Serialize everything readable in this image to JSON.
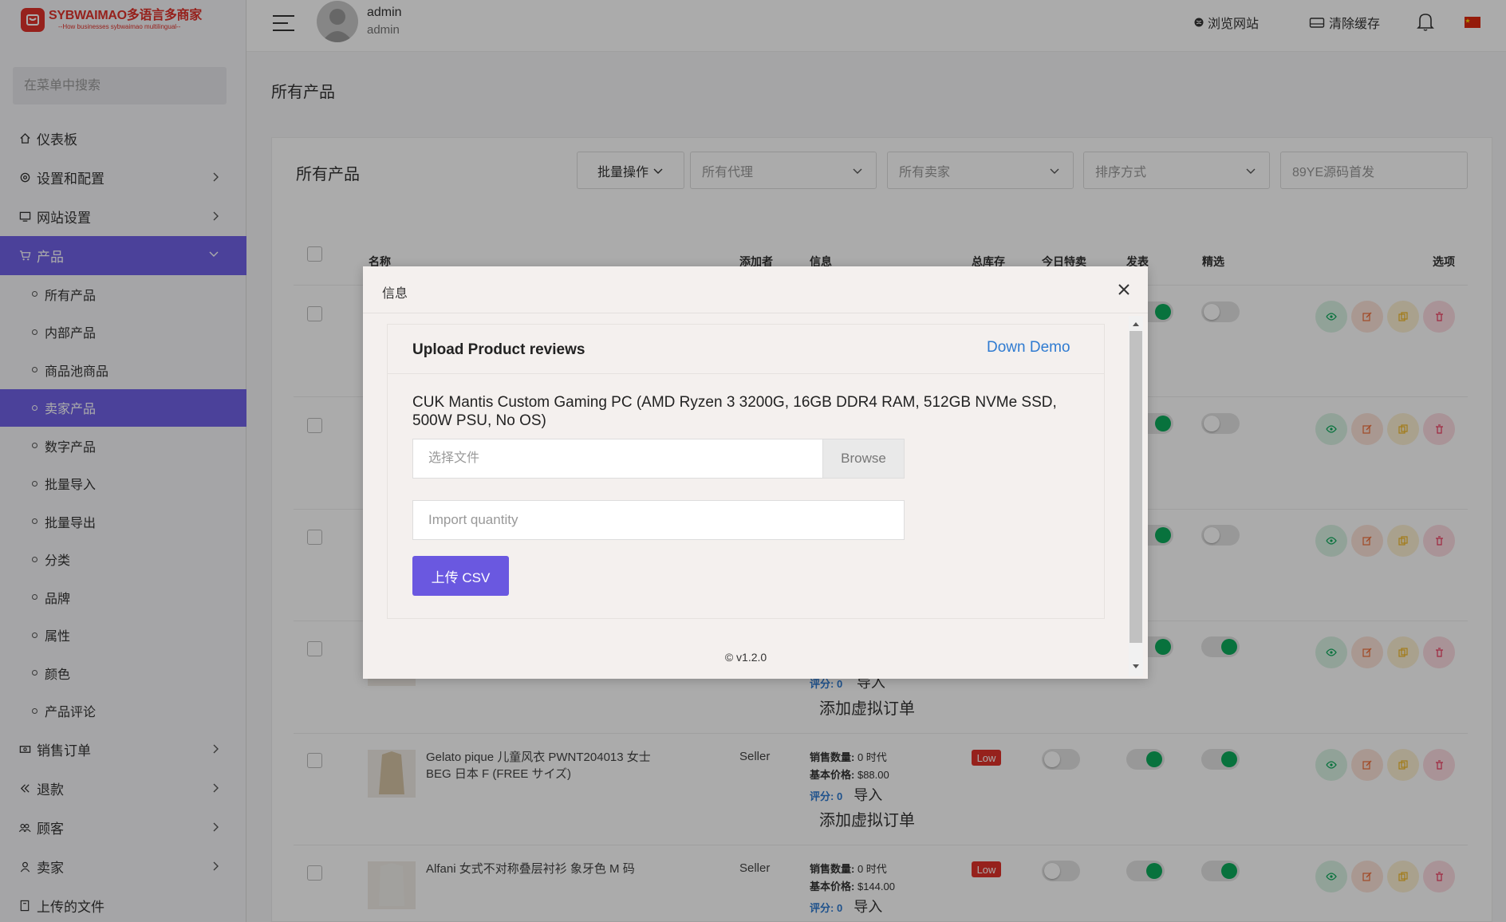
{
  "sidebar": {
    "logo_title": "SYBWAIMAO多语言多商家",
    "logo_sub": "--How businesses sybwaimao multilingual--",
    "search_placeholder": "在菜单中搜索",
    "items": [
      {
        "label": "仪表板",
        "icon": "home-icon"
      },
      {
        "label": "设置和配置",
        "icon": "settings-icon"
      },
      {
        "label": "网站设置",
        "icon": "monitor-icon"
      },
      {
        "label": "产品",
        "icon": "cart-icon"
      }
    ],
    "sub_items": [
      "所有产品",
      "内部产品",
      "商品池商品",
      "卖家产品",
      "数字产品",
      "批量导入",
      "批量导出",
      "分类",
      "品牌",
      "属性",
      "颜色",
      "产品评论"
    ],
    "items_after": [
      {
        "label": "销售订单",
        "icon": "money-icon"
      },
      {
        "label": "退款",
        "icon": "refund-icon"
      },
      {
        "label": "顾客",
        "icon": "users-icon"
      },
      {
        "label": "卖家",
        "icon": "user-icon"
      },
      {
        "label": "上传的文件",
        "icon": "file-icon"
      }
    ]
  },
  "topbar": {
    "user_name": "admin",
    "user_role": "admin",
    "browse_site": "浏览网站",
    "clear_cache": "清除缓存"
  },
  "page": {
    "title": "所有产品",
    "card_title": "所有产品",
    "filters": {
      "bulk": "批量操作",
      "agent": "所有代理",
      "seller": "所有卖家",
      "sort": "排序方式",
      "search_placeholder": "89YE源码首发"
    },
    "columns": {
      "name": "名称",
      "added_by": "添加者",
      "info": "信息",
      "stock": "总库存",
      "todays_deal": "今日特卖",
      "published": "发表",
      "featured": "精选",
      "options": "选项"
    },
    "rows": [
      {
        "rating_label": "评分:",
        "rating": "0",
        "import": "导入",
        "virtual_order": "添加虚拟订单"
      },
      {
        "name": "Gelato pique 儿童风衣 PWNT204013 女士 BEG 日本 F (FREE サイズ)",
        "seller": "Seller",
        "sales_label": "销售数量:",
        "sales": "0 时代",
        "price_label": "基本价格:",
        "price": "$88.00",
        "rating_label": "评分:",
        "rating": "0",
        "import": "导入",
        "virtual_order": "添加虚拟订单",
        "stock_badge": "Low"
      },
      {
        "name": "Alfani 女式不对称叠层衬衫 象牙色 M 码",
        "seller": "Seller",
        "sales_label": "销售数量:",
        "sales": "0 时代",
        "price_label": "基本价格:",
        "price": "$144.00",
        "rating_label": "评分:",
        "rating": "0",
        "import": "导入",
        "stock_badge": "Low"
      }
    ]
  },
  "modal": {
    "title": "信息",
    "upload_title": "Upload Product reviews",
    "demo_link": "Down Demo",
    "product_title": "CUK Mantis Custom Gaming PC (AMD Ryzen 3 3200G, 16GB DDR4 RAM, 512GB NVMe SSD, 500W PSU, No OS)",
    "file_placeholder": "选择文件",
    "browse": "Browse",
    "qty_placeholder": "Import quantity",
    "upload_button": "上传 CSV",
    "version": "© v1.2.0"
  },
  "colors": {
    "accent": "#7061e6",
    "brand": "#e0322b",
    "success": "#0dab5c",
    "link": "#2f7bd1"
  }
}
